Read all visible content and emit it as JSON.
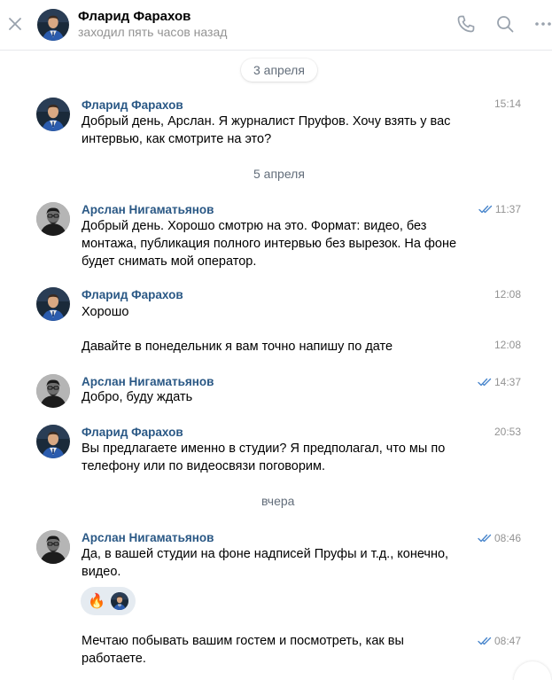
{
  "header": {
    "name": "Фларид Фарахов",
    "status": "заходил пять часов назад"
  },
  "icons": [
    "close-icon",
    "phone-icon",
    "search-icon",
    "more-icon",
    "double-check-icon",
    "fire-emoji-icon"
  ],
  "colors": {
    "author": "#2a5885",
    "time": "#939393",
    "accent": "#4986cc",
    "reaction_bg": "#e5ebf1"
  },
  "dates": [
    "3 апреля",
    "5 апреля",
    "вчера"
  ],
  "messages": [
    {
      "author": "Фларид Фарахов",
      "time": "15:14",
      "text": "Добрый день, Арслан. Я журналист Пруфов. Хочу взять у вас интервью, как смотрите на это?",
      "read": false
    },
    {
      "author": "Арслан Нигаматьянов",
      "time": "11:37",
      "text": "Добрый день. Хорошо смотрю на это. Формат: видео, без монтажа, публикация полного интервью без вырезок. На фоне будет снимать мой оператор.",
      "read": true
    },
    {
      "author": "Фларид Фарахов",
      "time": "12:08",
      "text": "Хорошо",
      "read": false
    },
    {
      "author": "",
      "time": "12:08",
      "text": "Давайте в понедельник я вам точно напишу по дате",
      "read": false
    },
    {
      "author": "Арслан Нигаматьянов",
      "time": "14:37",
      "text": "Добро, буду ждать",
      "read": true
    },
    {
      "author": "Фларид Фарахов",
      "time": "20:53",
      "text": "Вы предлагаете именно в студии? Я предполагал, что мы по телефону или по видеосвязи поговорим.",
      "read": false
    },
    {
      "author": "Арслан Нигаматьянов",
      "time": "08:46",
      "text": "Да, в вашей студии на фоне надписей Пруфы и т.д., конечно, видео.",
      "read": true
    },
    {
      "author": "",
      "time": "08:47",
      "text": "Мечтаю побывать вашим гостем и посмотреть, как вы работаете.",
      "read": true
    }
  ],
  "reaction": {
    "emoji": "🔥"
  }
}
